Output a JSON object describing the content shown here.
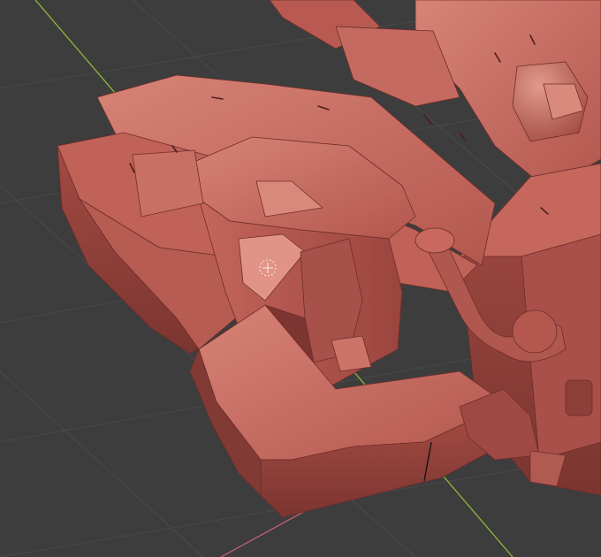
{
  "viewport": {
    "mode": "sculpt",
    "background_color": "#3d3d3d",
    "grid_color": "#4a4a4a",
    "axis_x_color": "#c8607a",
    "axis_y_color": "#8fb83a",
    "model_color": "#b85a52",
    "model_highlight": "#d8857a",
    "model_shadow": "#7a3530",
    "cursor_icon": "3d-cursor-icon",
    "brush_icon": "brush-cursor-icon"
  }
}
